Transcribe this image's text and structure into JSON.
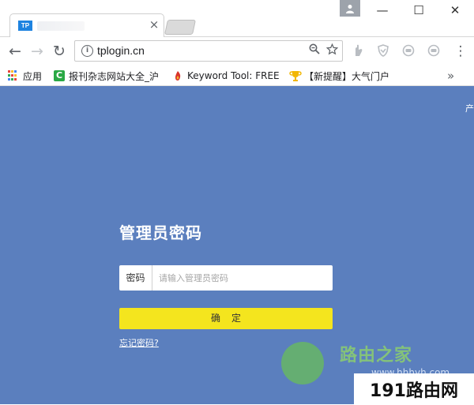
{
  "browser": {
    "tab": {
      "favicon_text": "TP",
      "close_glyph": "×"
    },
    "window_controls": {
      "minimize": "—",
      "maximize": "☐",
      "close": "✕"
    },
    "toolbar": {
      "back_glyph": "←",
      "forward_glyph": "→",
      "reload_glyph": "↻",
      "url": "tplogin.cn",
      "info_glyph": "i",
      "menu_glyph": "⋮"
    },
    "bookmarks": {
      "items": [
        {
          "label": "应用",
          "icon": "apps-grid-icon"
        },
        {
          "label": "报刊杂志网站大全_沪",
          "icon": "green-c-icon",
          "color": "#2aa845"
        },
        {
          "label": "Keyword Tool: FREE",
          "icon": "flame-icon",
          "color": "#d9342b"
        },
        {
          "label": "【新提醒】大气门户",
          "icon": "trophy-icon",
          "color": "#f2b705"
        }
      ],
      "overflow_glyph": "»"
    }
  },
  "page": {
    "corner_text": "产",
    "login": {
      "title": "管理员密码",
      "password_label": "密码",
      "password_placeholder": "请输入管理员密码",
      "confirm_label": "确定",
      "forgot_link": "忘记密码?"
    },
    "watermark": {
      "site_name": "路由之家",
      "site_url": "www.hhhyh.com",
      "badge": "191路由网"
    }
  },
  "colors": {
    "page_background": "#5b7fbe",
    "confirm_button": "#f4e51e",
    "tab_favicon": "#1e83e0"
  }
}
